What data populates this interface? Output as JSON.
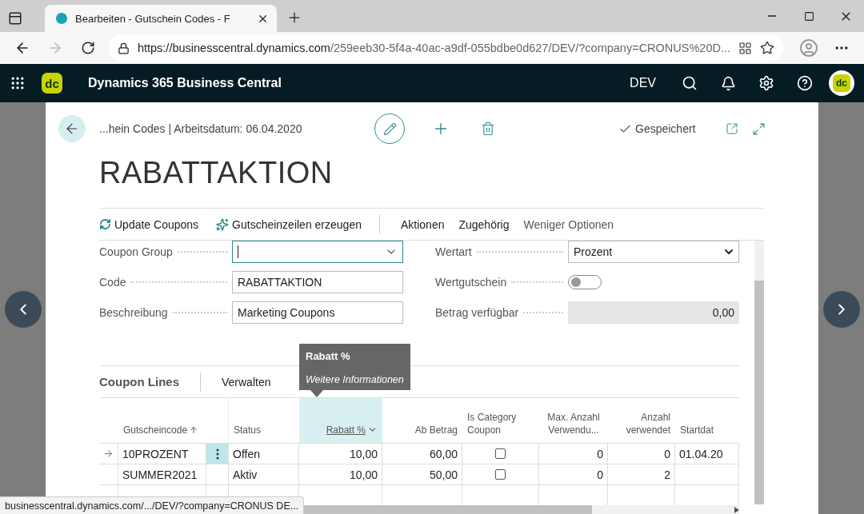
{
  "browser": {
    "tab_title": "Bearbeiten - Gutschein Codes - F",
    "url_host": "https://businesscentral.dynamics.com",
    "url_path": "/259eeb30-5f4a-40ac-a9df-055bdbe0d627/DEV/?company=CRONUS%20D...",
    "status_url": "businesscentral.dynamics.com/.../DEV/?company=CRONUS DE..."
  },
  "app": {
    "logo_text": "dc",
    "title": "Dynamics 365 Business Central",
    "company": "DEV",
    "avatar_text": "dc"
  },
  "page": {
    "breadcrumb": "...hein Codes | Arbeitsdatum: 06.04.2020",
    "saved": "Gespeichert",
    "title": "RABATTAKTION"
  },
  "actions": [
    {
      "label": "Update Coupons"
    },
    {
      "label": "Gutscheinzeilen erzeugen"
    }
  ],
  "menus": [
    "Aktionen",
    "Zugehörig"
  ],
  "less_options": "Weniger Optionen",
  "fields_left": [
    {
      "kind": "combo",
      "label": "Coupon Group"
    },
    {
      "kind": "text",
      "label": "Code",
      "value": "RABATTAKTION"
    },
    {
      "kind": "text",
      "label": "Beschreibung",
      "value": "Marketing Coupons"
    }
  ],
  "fields_right": [
    {
      "kind": "select",
      "label": "Wertart",
      "value": "Prozent"
    },
    {
      "kind": "toggle",
      "label": "Wertgutschein",
      "on": false
    },
    {
      "kind": "readonly",
      "label": "Betrag verfügbar",
      "value": "0,00"
    }
  ],
  "lines": {
    "title": "Coupon Lines",
    "menu": "Verwalten",
    "tooltip": {
      "title": "Rabatt %",
      "text": "Weitere Informationen"
    },
    "columns": [
      {
        "label": "Gutscheincode",
        "sort_ascending": true,
        "selected": false
      },
      {
        "label": "Status",
        "selected": false
      },
      {
        "label": "Rabatt %",
        "selected": true
      },
      {
        "label": "Ab Betrag",
        "selected": false
      },
      {
        "label": "Is Category Coupon",
        "selected": false
      },
      {
        "label": "Max. Anzahl Verwendu...",
        "selected": false
      },
      {
        "label": "Anzahl verwendet",
        "selected": false
      },
      {
        "label": "Startdat",
        "selected": false
      }
    ],
    "rows": [
      {
        "current": true,
        "code": "10PROZENT",
        "status": "Offen",
        "discount": "10,00",
        "min_amount": "60,00",
        "category_coupon": false,
        "max_uses": "0",
        "used": "0",
        "start": "01.04.20"
      },
      {
        "current": false,
        "code": "SUMMER2021",
        "status": "Aktiv",
        "discount": "10,00",
        "min_amount": "50,00",
        "category_coupon": false,
        "max_uses": "0",
        "used": "2"
      }
    ]
  }
}
